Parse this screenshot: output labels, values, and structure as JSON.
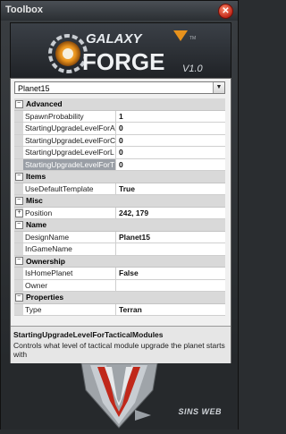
{
  "window": {
    "title": "Toolbox"
  },
  "logo": {
    "line1": "GALAXY",
    "line2": "FORGE",
    "version": "V1.0",
    "tm": "TM"
  },
  "selector": {
    "value": "Planet15"
  },
  "categories": [
    {
      "name": "Advanced",
      "expanded": true,
      "rows": [
        {
          "name": "SpawnProbability",
          "value": "1"
        },
        {
          "name": "StartingUpgradeLevelForA",
          "value": "0"
        },
        {
          "name": "StartingUpgradeLevelForC",
          "value": "0"
        },
        {
          "name": "StartingUpgradeLevelForL",
          "value": "0"
        },
        {
          "name": "StartingUpgradeLevelForT",
          "value": "0",
          "selected": true
        }
      ]
    },
    {
      "name": "Items",
      "expanded": true,
      "rows": [
        {
          "name": "UseDefaultTemplate",
          "value": "True"
        }
      ]
    },
    {
      "name": "Misc",
      "expanded": true,
      "rows": [
        {
          "name": "Position",
          "value": "242, 179",
          "expandable": true
        }
      ]
    },
    {
      "name": "Name",
      "expanded": true,
      "rows": [
        {
          "name": "DesignName",
          "value": "Planet15"
        },
        {
          "name": "InGameName",
          "value": ""
        }
      ]
    },
    {
      "name": "Ownership",
      "expanded": true,
      "rows": [
        {
          "name": "IsHomePlanet",
          "value": "False"
        },
        {
          "name": "Owner",
          "value": ""
        }
      ]
    },
    {
      "name": "Properties",
      "expanded": true,
      "rows": [
        {
          "name": "Type",
          "value": "Terran"
        }
      ]
    }
  ],
  "description": {
    "title": "StartingUpgradeLevelForTacticalModules",
    "text": "Controls what level of tactical module upgrade the planet starts with"
  },
  "footer": {
    "brand": "SINS WEB"
  },
  "colors": {
    "accent": "#e8921c",
    "close": "#c0281a",
    "selection": "#9a9fa6"
  }
}
